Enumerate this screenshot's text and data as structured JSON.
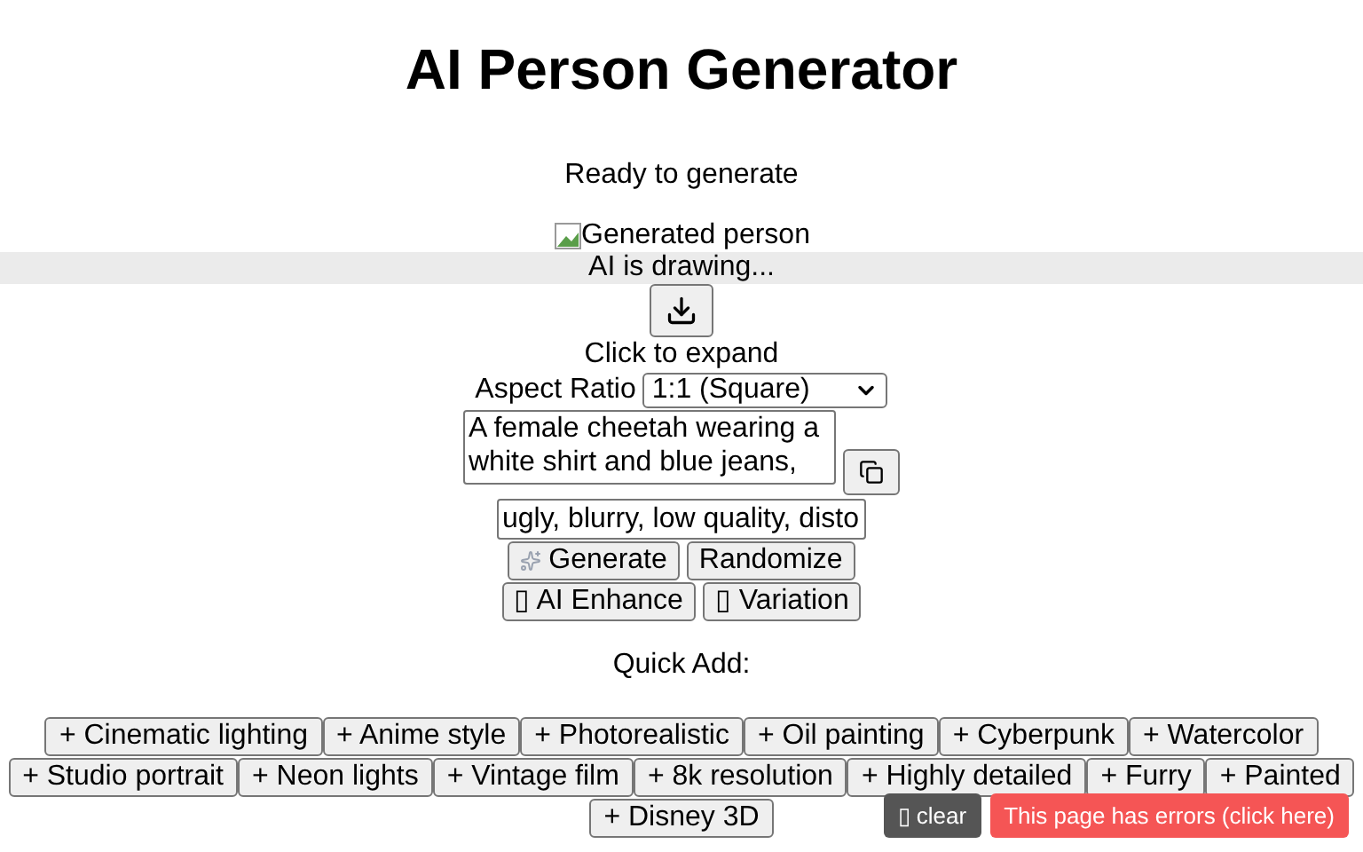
{
  "title": "AI Person Generator",
  "status": "Ready to generate",
  "image": {
    "alt": "Generated person",
    "overlay": "AI is drawing..."
  },
  "expand_hint": "Click to expand",
  "aspect_ratio": {
    "label": "Aspect Ratio",
    "value": "1:1 (Square)"
  },
  "prompt": {
    "value": "A female cheetah wearing a white shirt and blue jeans,"
  },
  "negative_prompt": {
    "value": "ugly, blurry, low quality, disto"
  },
  "actions": [
    {
      "label": "Generate",
      "icon": true
    },
    {
      "label": "Randomize",
      "icon": false
    }
  ],
  "actions_2": [
    {
      "label": "▯ AI Enhance"
    },
    {
      "label": "▯ Variation"
    }
  ],
  "quick_add": {
    "title": "Quick Add:",
    "items": [
      "+ Cinematic lighting",
      "+ Anime style",
      "+ Photorealistic",
      "+ Oil painting",
      "+ Cyberpunk",
      "+ Watercolor",
      "+ Studio portrait",
      "+ Neon lights",
      "+ Vintage film",
      "+ 8k resolution",
      "+ Highly detailed",
      "+ Furry",
      "+ Painted",
      "+ Disney 3D"
    ]
  },
  "console": {
    "clear": "▯ clear",
    "errors": "This page has errors (click here)"
  }
}
